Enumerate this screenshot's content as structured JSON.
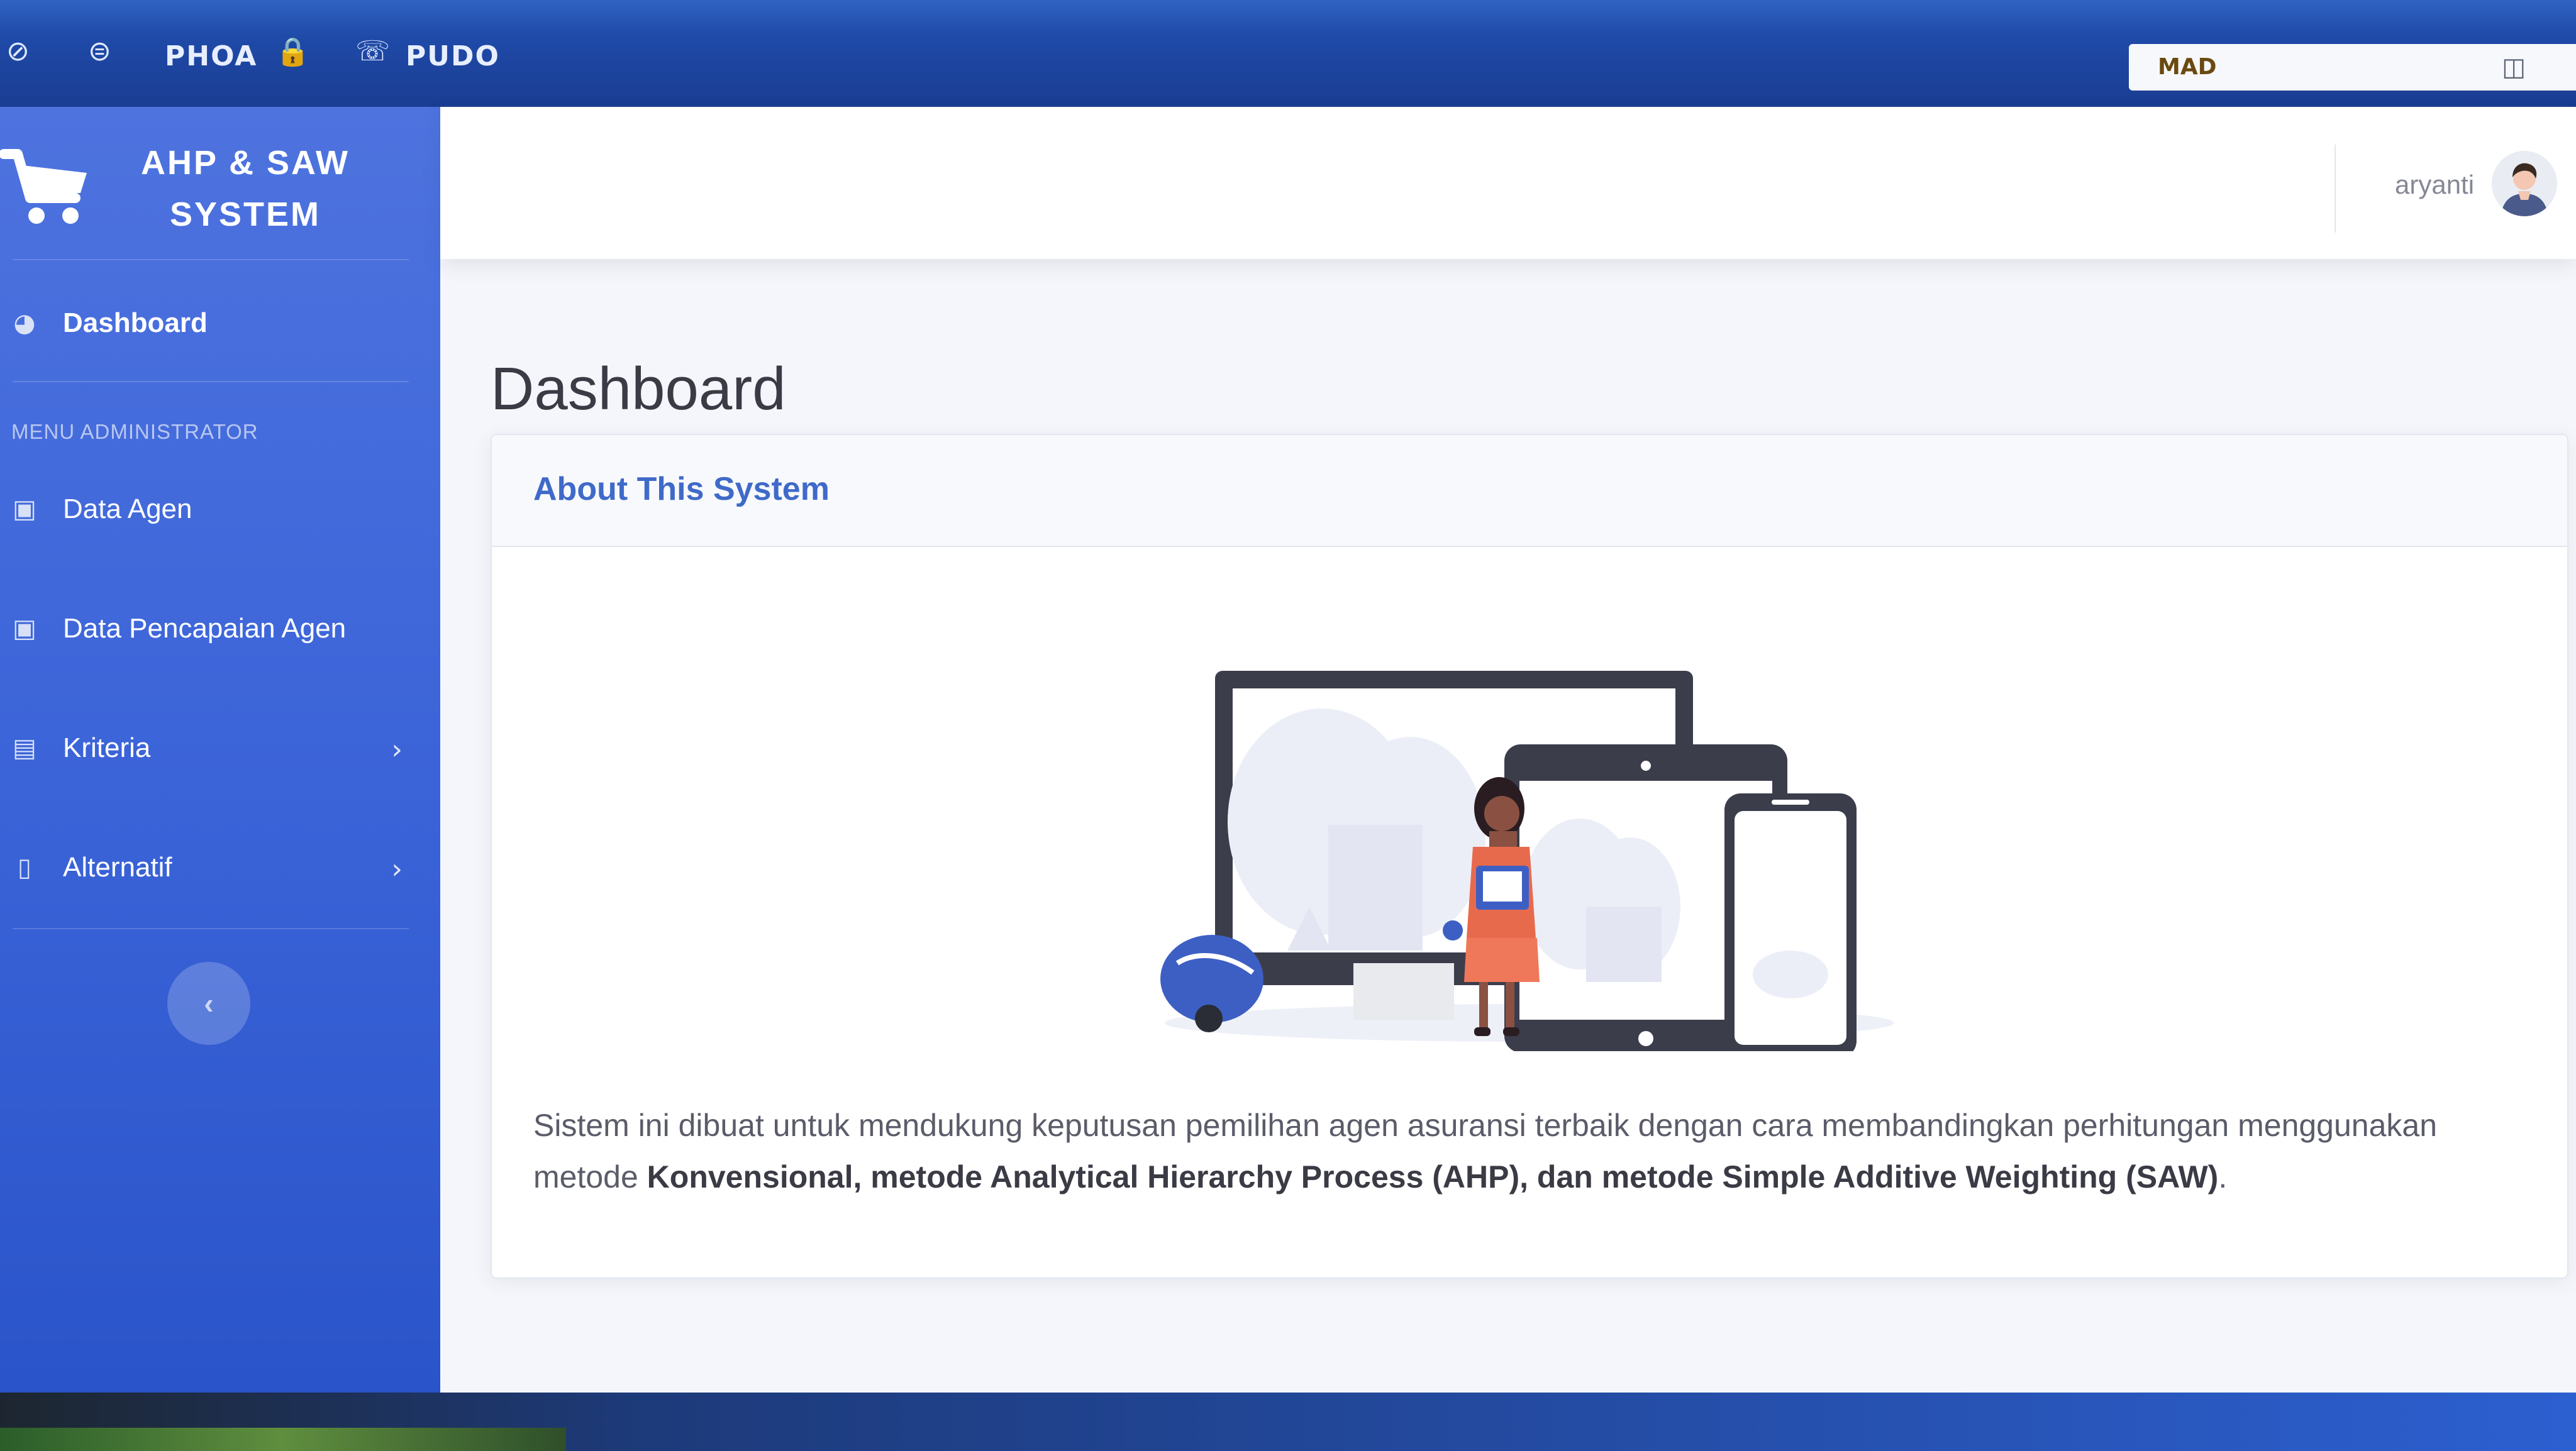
{
  "browser": {
    "tab_labels": [
      "PHOA",
      "PUDO"
    ],
    "address_text": "MAD"
  },
  "brand": {
    "title": "AHP & SAW SYSTEM"
  },
  "sidebar": {
    "dashboard_label": "Dashboard",
    "section_heading": "MENU ADMINISTRATOR",
    "items": [
      {
        "label": "Data Agen",
        "icon": "id-card-icon",
        "has_chevron": false
      },
      {
        "label": "Data Pencapaian Agen",
        "icon": "id-card-icon",
        "has_chevron": false
      },
      {
        "label": "Kriteria",
        "icon": "clipboard-icon",
        "has_chevron": true
      },
      {
        "label": "Alternatif",
        "icon": "id-badge-icon",
        "has_chevron": true
      }
    ],
    "toggle_icon": "chevron-left-icon"
  },
  "topnav": {
    "username": "aryanti"
  },
  "main": {
    "page_title": "Dashboard",
    "card_title": "About This System",
    "description_plain": "Sistem ini dibuat untuk mendukung keputusan pemilihan agen asuransi terbaik dengan cara membandingkan perhitungan menggunakan metode ",
    "description_bold": "Konvensional, metode Analytical Hierarchy Process (AHP), dan metode Simple Additive Weighting (SAW)",
    "description_end": "."
  },
  "colors": {
    "sidebar_primary": "#4e73df",
    "card_title": "#3f6ac9",
    "text_body": "#5a5c69"
  }
}
